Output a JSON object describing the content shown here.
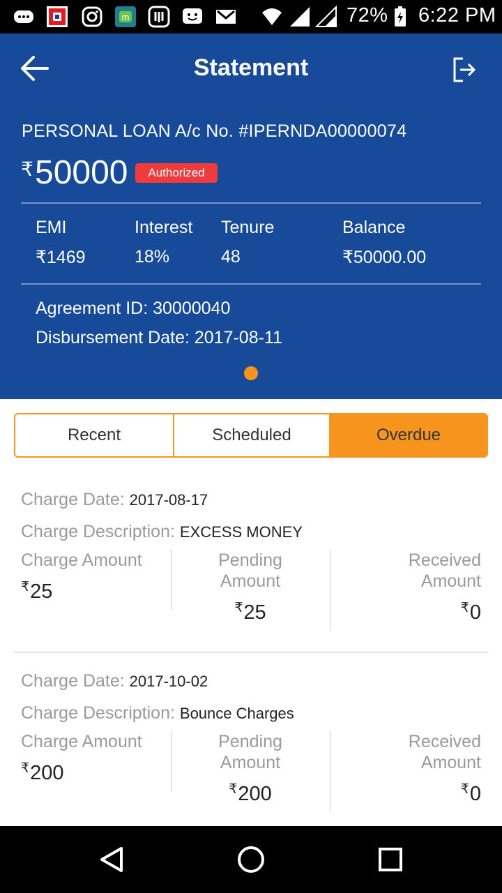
{
  "status_bar": {
    "battery": "72%",
    "time": "6:22 PM"
  },
  "header": {
    "title": "Statement",
    "loan_account": "PERSONAL LOAN A/c No. #IPERNDA00000074",
    "currency_symbol": "₹",
    "amount": "50000",
    "status_badge": "Authorized",
    "stats": [
      {
        "label": "EMI",
        "value": "₹1469"
      },
      {
        "label": "Interest",
        "value": "18%"
      },
      {
        "label": "Tenure",
        "value": "48"
      },
      {
        "label": "Balance",
        "value": "₹50000.00"
      }
    ],
    "agreement": "Agreement ID: 30000040",
    "disbursement": "Disbursement Date: 2017-08-11"
  },
  "tabs": [
    {
      "label": "Recent",
      "active": false
    },
    {
      "label": "Scheduled",
      "active": false
    },
    {
      "label": "Overdue",
      "active": true
    }
  ],
  "labels": {
    "charge_date": "Charge Date:",
    "charge_description": "Charge Description:",
    "charge_amount": "Charge Amount",
    "pending_amount": "Pending Amount",
    "received_amount": "Received Amount",
    "currency": "₹"
  },
  "charges": [
    {
      "date": "2017-08-17",
      "description": "EXCESS MONEY",
      "charge_amount": "25",
      "pending_amount": "25",
      "received_amount": "0"
    },
    {
      "date": "2017-10-02",
      "description": "Bounce Charges",
      "charge_amount": "200",
      "pending_amount": "200",
      "received_amount": "0"
    }
  ],
  "colors": {
    "header_bg": "#174a99",
    "accent": "#f7941e",
    "badge": "#ef3b3b"
  },
  "icons": [
    "back-arrow-icon",
    "logout-icon",
    "back-triangle-icon",
    "home-circle-icon",
    "recents-square-icon"
  ]
}
